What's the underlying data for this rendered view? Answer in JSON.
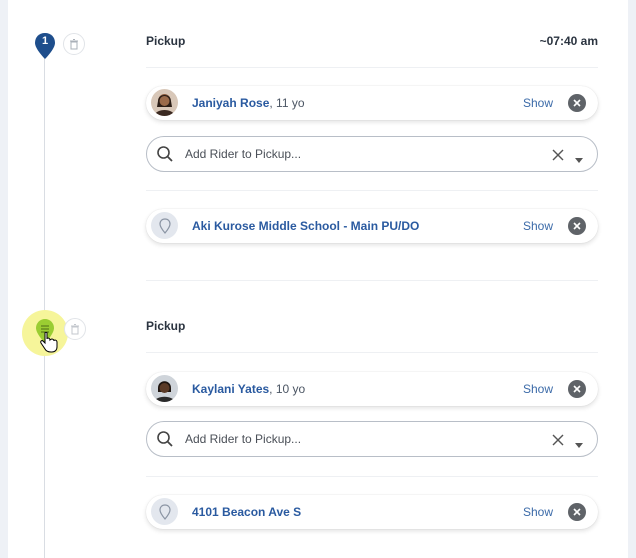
{
  "stops": [
    {
      "number": "1",
      "title": "Pickup",
      "time": "~07:40 am",
      "rider": {
        "name": "Janiyah Rose",
        "age": ", 11 yo",
        "show": "Show"
      },
      "search": {
        "placeholder": "Add Rider to Pickup..."
      },
      "location": {
        "name": "Aki Kurose Middle School - Main PU/DO",
        "show": "Show"
      }
    },
    {
      "title": "Pickup",
      "rider": {
        "name": "Kaylani Yates",
        "age": ", 10 yo",
        "show": "Show"
      },
      "search": {
        "placeholder": "Add Rider to Pickup..."
      },
      "location": {
        "name": "4101 Beacon Ave S",
        "show": "Show"
      }
    }
  ],
  "colors": {
    "accent": "#1e4e8c",
    "link": "#2a5aa0",
    "pending_pin": "#9acd32",
    "highlight": "#f6f59a"
  }
}
